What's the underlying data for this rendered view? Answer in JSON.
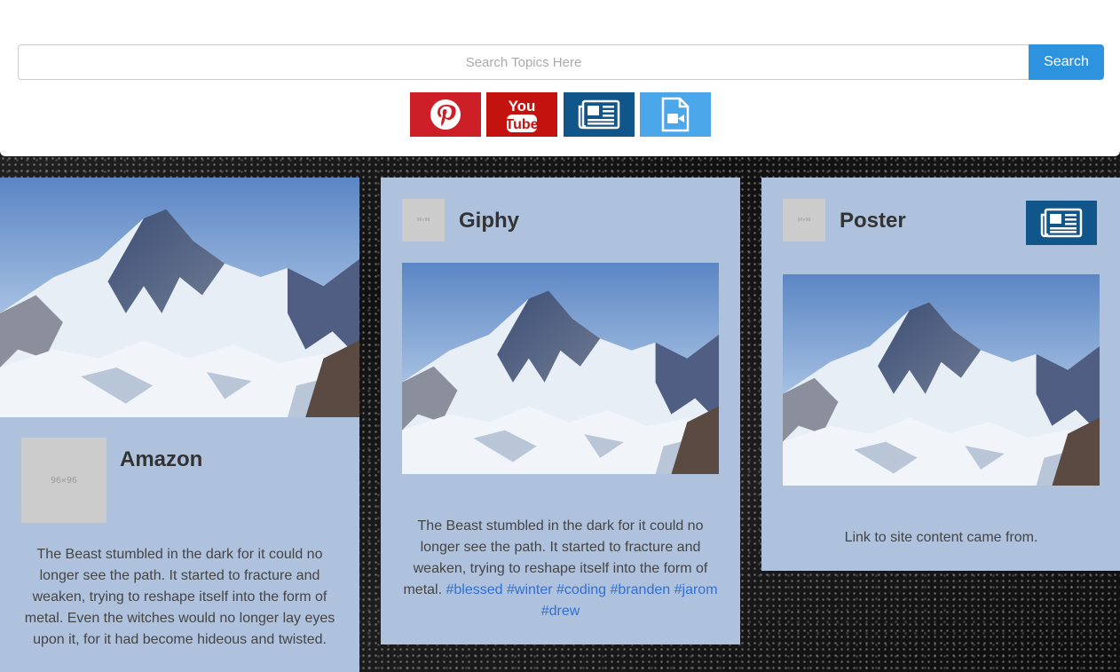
{
  "search": {
    "placeholder": "Search Topics Here",
    "value": "",
    "button_label": "Search"
  },
  "filters": [
    {
      "name": "pinterest",
      "icon": "pinterest-icon",
      "color": "#cc1f27"
    },
    {
      "name": "youtube",
      "icon": "youtube-icon",
      "color": "#c4120f",
      "label_top": "You",
      "label_bottom": "Tube"
    },
    {
      "name": "news",
      "icon": "newspaper-icon",
      "color": "#11568b"
    },
    {
      "name": "video",
      "icon": "video-file-icon",
      "color": "#4ba7ea"
    }
  ],
  "cards": {
    "amazon": {
      "title": "Amazon",
      "thumb_label": "96×96",
      "text": "The Beast stumbled in the dark for it could no longer see the path. It started to fracture and weaken, trying to reshape itself into the form of metal. Even the witches would no longer lay eyes upon it, for it had become hideous and twisted."
    },
    "giphy": {
      "title": "Giphy",
      "thumb_label": "96×96",
      "text": "The Beast stumbled in the dark for it could no longer see the path. It started to fracture and weaken, trying to reshape itself into the form of metal.",
      "tags": [
        "#blessed",
        "#winter",
        "#coding",
        "#branden",
        "#jarom",
        "#drew"
      ]
    },
    "poster": {
      "title": "Poster",
      "thumb_label": "96×96",
      "badge_icon": "newspaper-icon",
      "text": "Link to site content came from."
    }
  },
  "colors": {
    "card_bg": "#afc2dd",
    "search_button": "#2d93de",
    "tag_link": "#2f6fd6"
  }
}
